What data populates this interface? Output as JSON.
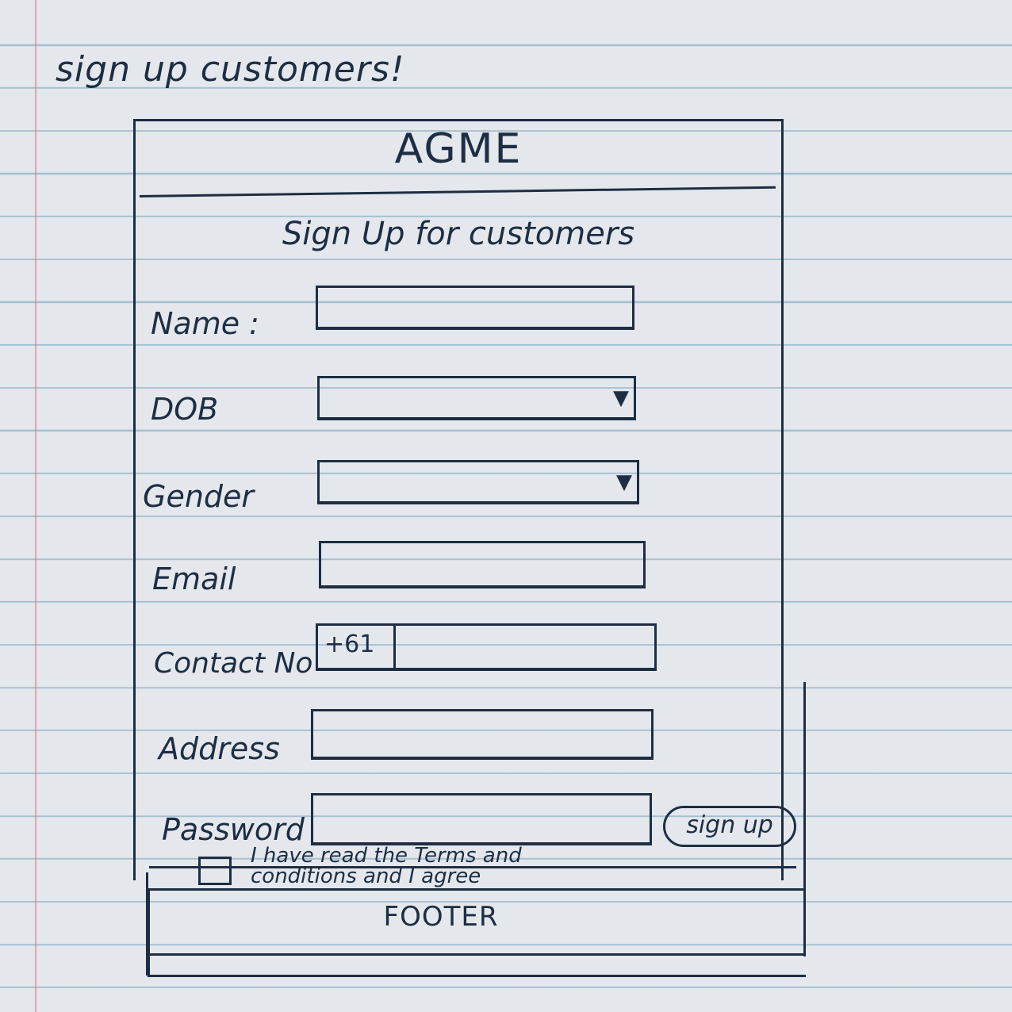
{
  "page": {
    "heading": "sign up customers!"
  },
  "header": {
    "brand": "AGME"
  },
  "form": {
    "title": "Sign Up for customers",
    "fields": {
      "name": {
        "label": "Name :"
      },
      "dob": {
        "label": "DOB",
        "arrow": "▼"
      },
      "gender": {
        "label": "Gender",
        "arrow": "▼"
      },
      "email": {
        "label": "Email"
      },
      "contact": {
        "label": "Contact No",
        "prefix": "+61"
      },
      "address": {
        "label": "Address"
      },
      "password": {
        "label": "Password"
      }
    },
    "signup_label": "sign up",
    "agree_text": "I have read the Terms and conditions and I agree"
  },
  "footer": {
    "label": "FOOTER"
  }
}
